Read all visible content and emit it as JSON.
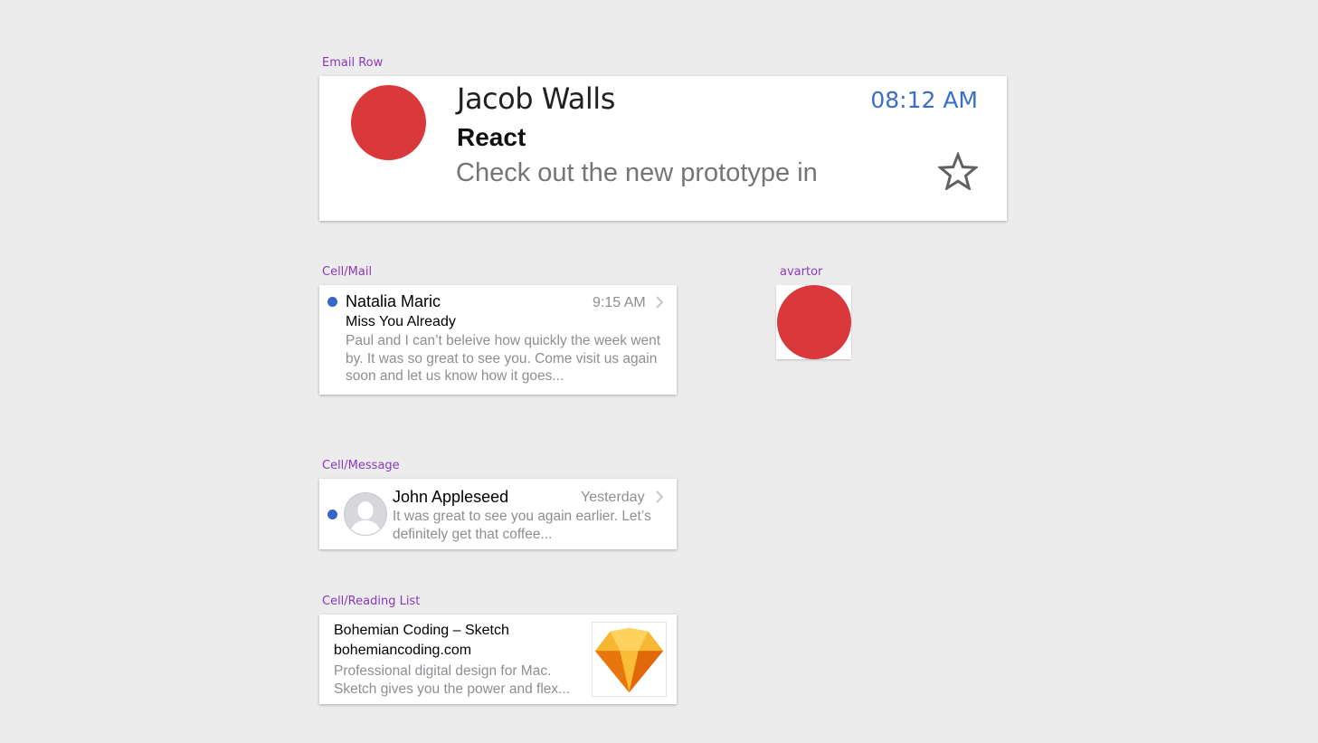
{
  "colors": {
    "avatar_red": "#d9393b",
    "accent_blue": "#3b6fc7",
    "unread_dot": "#3566c8",
    "label_purple": "#8a3ab9"
  },
  "artboards": {
    "email_row": {
      "label": "Email Row",
      "sender": "Jacob Walls",
      "subject": "React",
      "preview": "Check out the new prototype in",
      "time": "08:12 AM",
      "star_icon": "star-outline-icon"
    },
    "cell_mail": {
      "label": "Cell/Mail",
      "sender": "Natalia Maric",
      "time": "9:15 AM",
      "subject": "Miss You Already",
      "preview": "Paul and I can’t beleive how quickly the week went by. It was so great to see you. Come visit us again soon and let us know how it goes..."
    },
    "avatar": {
      "label": "avartor"
    },
    "cell_message": {
      "label": "Cell/Message",
      "sender": "John Appleseed",
      "time": "Yesterday",
      "preview": "It was great to see you again earlier. Let’s definitely get that coffee..."
    },
    "cell_reading": {
      "label": "Cell/Reading List",
      "title": "Bohemian Coding – Sketch",
      "url": "bohemiancoding.com",
      "description": "Professional digital design for Mac. Sketch gives you the power and flex...",
      "thumbnail_icon": "sketch-diamond-icon"
    }
  }
}
